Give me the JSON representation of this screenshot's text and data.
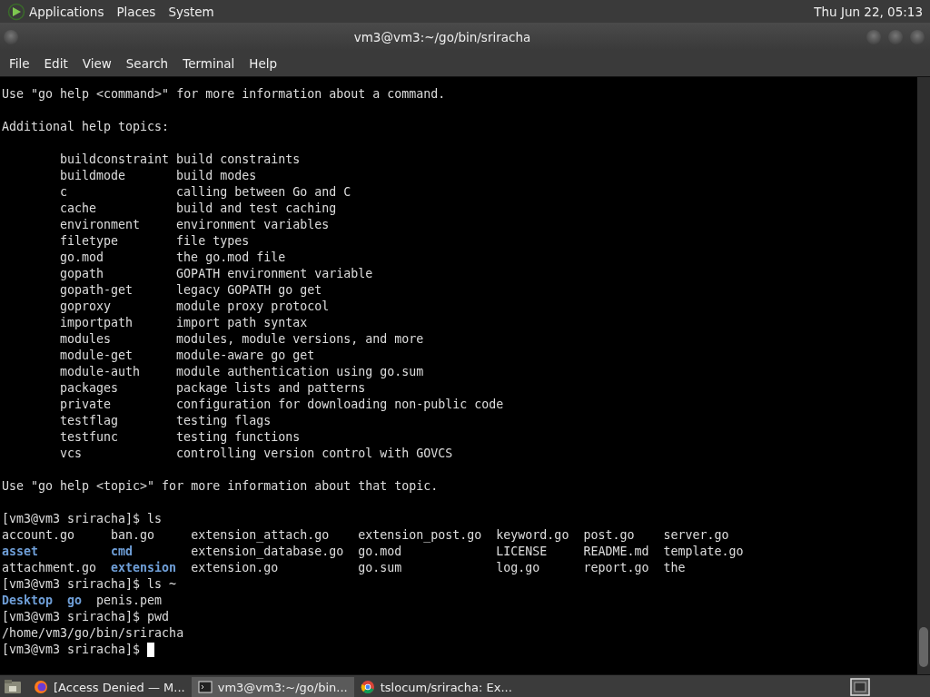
{
  "top_panel": {
    "menus": [
      "Applications",
      "Places",
      "System"
    ],
    "clock": "Thu Jun 22, 05:13"
  },
  "window": {
    "title": "vm3@vm3:~/go/bin/sriracha"
  },
  "menu_bar": [
    "File",
    "Edit",
    "View",
    "Search",
    "Terminal",
    "Help"
  ],
  "terminal": [
    {
      "kind": "line",
      "text": "Use \"go help <command>\" for more information about a command."
    },
    {
      "kind": "blank"
    },
    {
      "kind": "line",
      "text": "Additional help topics:"
    },
    {
      "kind": "blank"
    },
    {
      "kind": "topics",
      "items": [
        {
          "name": "buildconstraint",
          "description": "build constraints"
        },
        {
          "name": "buildmode",
          "description": "build modes"
        },
        {
          "name": "c",
          "description": "calling between Go and C"
        },
        {
          "name": "cache",
          "description": "build and test caching"
        },
        {
          "name": "environment",
          "description": "environment variables"
        },
        {
          "name": "filetype",
          "description": "file types"
        },
        {
          "name": "go.mod",
          "description": "the go.mod file"
        },
        {
          "name": "gopath",
          "description": "GOPATH environment variable"
        },
        {
          "name": "gopath-get",
          "description": "legacy GOPATH go get"
        },
        {
          "name": "goproxy",
          "description": "module proxy protocol"
        },
        {
          "name": "importpath",
          "description": "import path syntax"
        },
        {
          "name": "modules",
          "description": "modules, module versions, and more"
        },
        {
          "name": "module-get",
          "description": "module-aware go get"
        },
        {
          "name": "module-auth",
          "description": "module authentication using go.sum"
        },
        {
          "name": "packages",
          "description": "package lists and patterns"
        },
        {
          "name": "private",
          "description": "configuration for downloading non-public code"
        },
        {
          "name": "testflag",
          "description": "testing flags"
        },
        {
          "name": "testfunc",
          "description": "testing functions"
        },
        {
          "name": "vcs",
          "description": "controlling version control with GOVCS"
        }
      ]
    },
    {
      "kind": "blank"
    },
    {
      "kind": "line",
      "text": "Use \"go help <topic>\" for more information about that topic."
    },
    {
      "kind": "blank"
    },
    {
      "kind": "prompt",
      "prompt": "[vm3@vm3 sriracha]$",
      "command": "ls"
    },
    {
      "kind": "listing",
      "rows": [
        [
          {
            "name": "account.go",
            "kind": "file"
          },
          {
            "name": "ban.go",
            "kind": "file"
          },
          {
            "name": "extension_attach.go",
            "kind": "file"
          },
          {
            "name": "extension_post.go",
            "kind": "file"
          },
          {
            "name": "keyword.go",
            "kind": "file"
          },
          {
            "name": "post.go",
            "kind": "file"
          },
          {
            "name": "server.go",
            "kind": "file"
          }
        ],
        [
          {
            "name": "asset",
            "kind": "dir"
          },
          {
            "name": "cmd",
            "kind": "dir"
          },
          {
            "name": "extension_database.go",
            "kind": "file"
          },
          {
            "name": "go.mod",
            "kind": "file"
          },
          {
            "name": "LICENSE",
            "kind": "file"
          },
          {
            "name": "README.md",
            "kind": "file"
          },
          {
            "name": "template.go",
            "kind": "file"
          }
        ],
        [
          {
            "name": "attachment.go",
            "kind": "file"
          },
          {
            "name": "extension",
            "kind": "dir"
          },
          {
            "name": "extension.go",
            "kind": "file"
          },
          {
            "name": "go.sum",
            "kind": "file"
          },
          {
            "name": "log.go",
            "kind": "file"
          },
          {
            "name": "report.go",
            "kind": "file"
          },
          {
            "name": "the",
            "kind": "file"
          }
        ]
      ]
    },
    {
      "kind": "prompt",
      "prompt": "[vm3@vm3 sriracha]$",
      "command": "ls ~"
    },
    {
      "kind": "listing",
      "rows": [
        [
          {
            "name": "Desktop",
            "kind": "dir"
          },
          {
            "name": "go",
            "kind": "dir"
          },
          {
            "name": "penis.pem",
            "kind": "file"
          }
        ]
      ]
    },
    {
      "kind": "prompt",
      "prompt": "[vm3@vm3 sriracha]$",
      "command": "pwd"
    },
    {
      "kind": "line",
      "text": "/home/vm3/go/bin/sriracha"
    },
    {
      "kind": "prompt",
      "prompt": "[vm3@vm3 sriracha]$",
      "cursor": true
    }
  ],
  "taskbar": [
    {
      "label": "[Access Denied — M...",
      "selected": false
    },
    {
      "label": "vm3@vm3:~/go/bin...",
      "selected": true
    },
    {
      "label": "tslocum/sriracha: Ex...",
      "selected": false
    }
  ]
}
